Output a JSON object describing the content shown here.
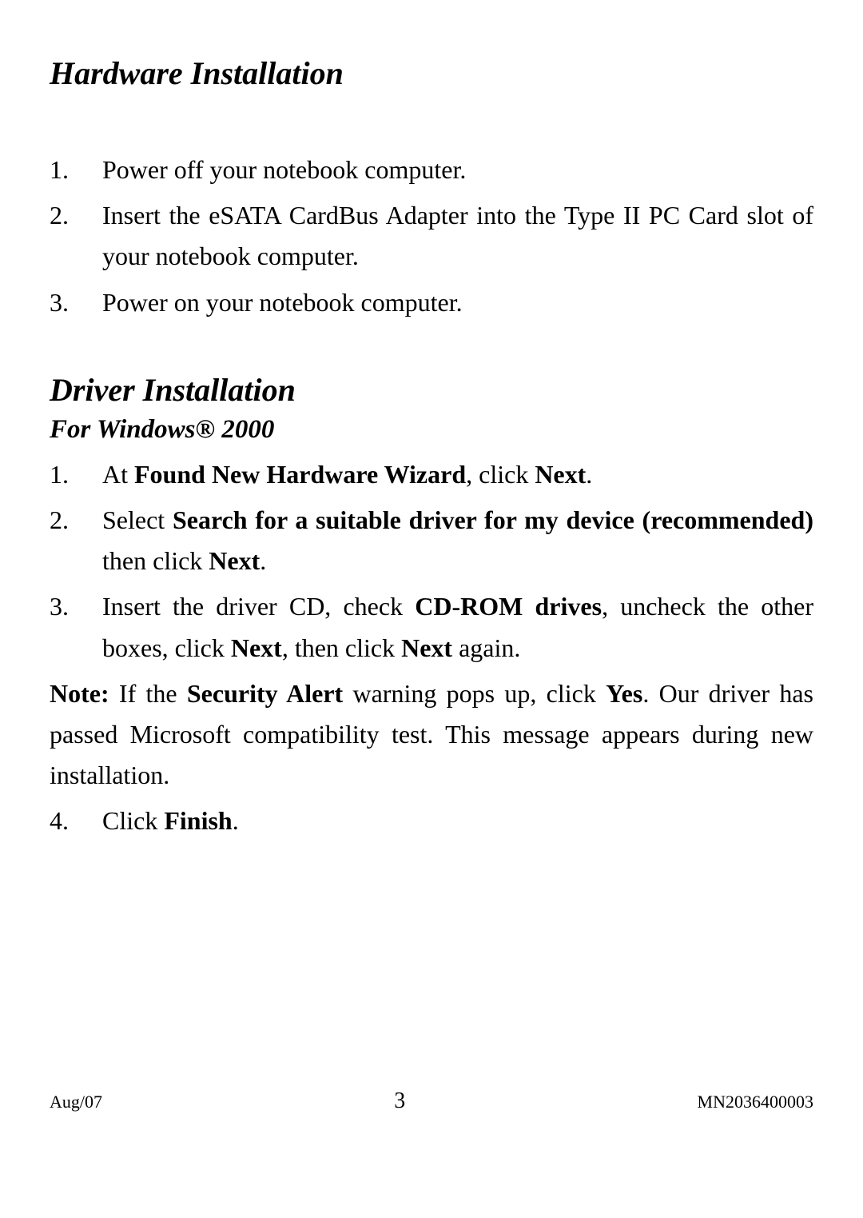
{
  "sections": {
    "hardware": {
      "title": "Hardware Installation",
      "items": [
        {
          "num": "1.",
          "text": "Power off your notebook computer."
        },
        {
          "num": "2.",
          "text": "Insert the eSATA CardBus Adapter into the Type II PC Card slot of your notebook computer."
        },
        {
          "num": "3.",
          "text": "Power on your notebook computer."
        }
      ]
    },
    "driver": {
      "title": "Driver Installation",
      "subtitle": "For Windows® 2000",
      "items": {
        "i1": {
          "num": "1.",
          "p1": "At ",
          "b1": "Found New Hardware Wizard",
          "p2": ", click ",
          "b2": "Next",
          "p3": "."
        },
        "i2": {
          "num": "2.",
          "p1": "Select ",
          "b1": "Search for a suitable driver for my device (recommended)",
          "p2": " then click ",
          "b2": "Next",
          "p3": "."
        },
        "i3": {
          "num": "3.",
          "p1": "Insert the driver CD, check ",
          "b1": "CD-ROM drives",
          "p2": ", uncheck the other boxes, click ",
          "b2": "Next",
          "p3": ", then click ",
          "b3": "Next",
          "p4": " again."
        },
        "i4": {
          "num": "4.",
          "p1": "Click ",
          "b1": "Finish",
          "p2": "."
        }
      },
      "note": {
        "label": "Note:",
        "p1": " If the ",
        "b1": "Security Alert",
        "p2": " warning pops up, click ",
        "b2": "Yes",
        "p3": ". Our driver has passed Microsoft compatibility test. This message appears during new installation."
      }
    }
  },
  "footer": {
    "left": "Aug/07",
    "center": "3",
    "right": "MN2036400003"
  }
}
